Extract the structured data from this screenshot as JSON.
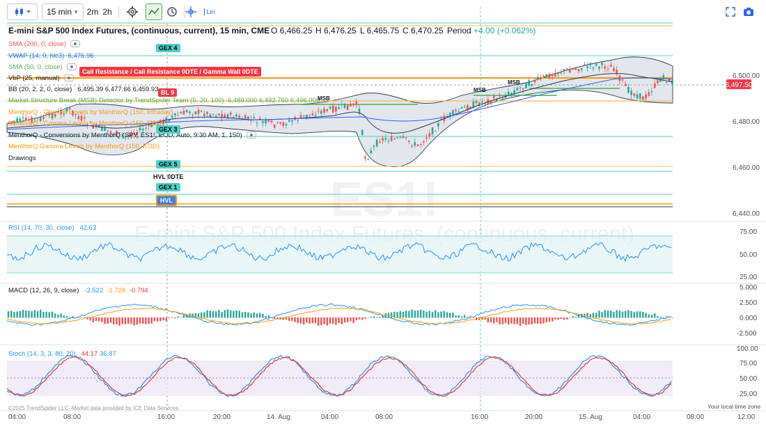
{
  "toolbar": {
    "interval": "15 min",
    "quick_2m": "2m",
    "quick_2h": "2h",
    "scale_label": "Lin"
  },
  "chart": {
    "title": "E-mini S&P 500 Index Futures, (continuous, current), 15 min, CME",
    "open_label": "O",
    "open": "6,466.25",
    "high_label": "H",
    "high": "6,476.25",
    "low_label": "L",
    "low": "6,465.75",
    "close_label": "C",
    "close": "6,470.25",
    "period_label": "Period",
    "period": "+4.00 (+0.062%)",
    "last_price": "6,497.50",
    "watermark_symbol": "ES1!",
    "watermark_name": "E-mini S&P 500 Index Futures, (continuous, current)"
  },
  "indicators": {
    "sma200": "SMA (200, 0, close)",
    "vwap": "VWAP (14, 0, hlc3)",
    "vwap_value": "6,476.96",
    "sma50": "SMA (50, 0, close)",
    "vbp": "VbP (25, manual)",
    "bb": "BB (20, 2, 2, 0, close)",
    "bb_values": "6,495.39 6,477.66 6,459.93",
    "msb": "Market Structure Break (MSB) Detector by TrendSpider Team (5, 20, 100)",
    "msb_values": "6,489.000 6,492.750 6,496.000",
    "menthor1": "MenthorQ - Gamma Levels by MenthorQ (150, Intraday)",
    "menthor2": "MenthorQ - Gamma Levels by MenthorQ (150, EOD)",
    "menthor3": "MenthorQ - Conversions by MenthorQ (SPY, ES1!, EOD, Auto, 9:30 AM, 1, 150)",
    "menthor4": "MenthorQ Gamma Levels by MenthorQ (150, EOD)",
    "drawings": "Drawings"
  },
  "level_tags": {
    "gex4": "GEX 4",
    "call_resistance": "Call Resistance / Call Resistance 0DTE / Gamma Wall 0DTE",
    "bl9": "BL 9",
    "gex3": "GEX 3",
    "gex5": "GEX 5",
    "hvl0dte": "HVL 0DTE",
    "gex1": "GEX 1",
    "hvl": "HVL",
    "msb": "MSB"
  },
  "price_axis": [
    "6,500.00",
    "6,480.00",
    "6,460.00",
    "6,440.00"
  ],
  "rsi": {
    "label": "RSI (14, 70, 30, close)",
    "value": "42.63",
    "axis": [
      "75.00",
      "50.00",
      "25.00"
    ]
  },
  "macd": {
    "label": "MACD (12, 26, 9, close)",
    "v1": "-2.522",
    "v2": "-1.728",
    "v3": "-0.794",
    "axis": [
      "5.000",
      "2.500",
      "0.000",
      "-2.500"
    ]
  },
  "stoch": {
    "label": "Stoch (14, 3, 3, 80, 20)",
    "v1": "44.17",
    "v2": "36.87",
    "axis": [
      "100.00",
      "75.00",
      "50.00",
      "25.00"
    ]
  },
  "time_axis": [
    "04:00",
    "08:00",
    "16:00",
    "20:00",
    "14. Aug",
    "04:00",
    "08:00",
    "16:00",
    "20:00",
    "15. Aug",
    "04:00",
    "08:00",
    "12:00"
  ],
  "footer": {
    "copyright": "©2025 TrendSpider LLC. Market data provided by ICE Data Services",
    "local_time": "Your local time zone"
  },
  "colors": {
    "up": "#26a69a",
    "down": "#ef5350",
    "bb_fill": "#d9e1ea",
    "accent": "#f23645"
  }
}
